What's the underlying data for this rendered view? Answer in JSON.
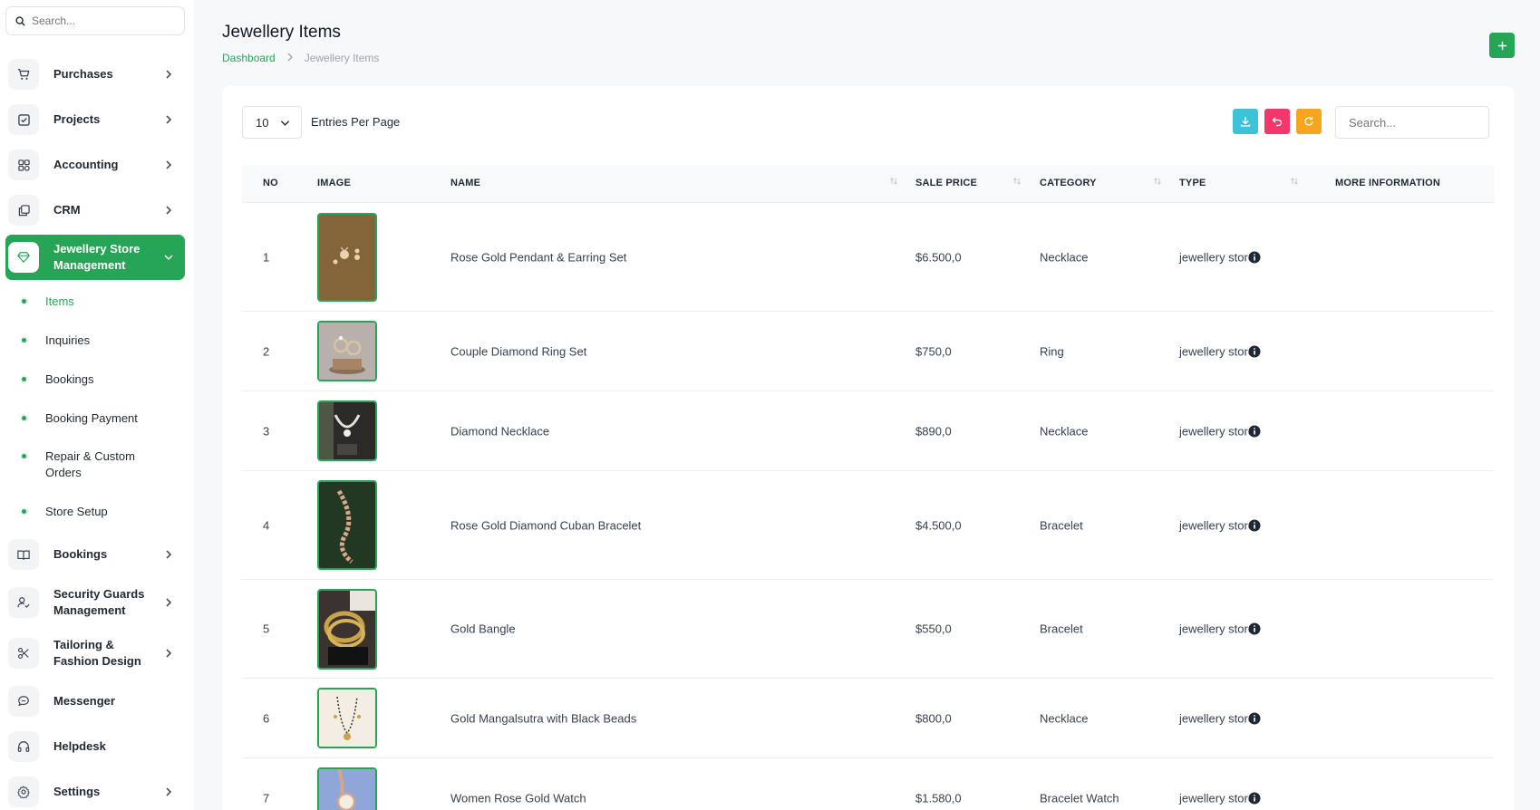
{
  "sidebar": {
    "search_placeholder": "Search...",
    "nav": [
      {
        "label": "Purchases",
        "icon": "cart-icon"
      },
      {
        "label": "Projects",
        "icon": "checkbox-icon"
      },
      {
        "label": "Accounting",
        "icon": "grid-icon"
      },
      {
        "label": "CRM",
        "icon": "copy-icon"
      },
      {
        "label": "Jewellery Store Management",
        "icon": "gem-icon"
      }
    ],
    "sub": [
      {
        "label": "Items"
      },
      {
        "label": "Inquiries"
      },
      {
        "label": "Bookings"
      },
      {
        "label": "Booking Payment"
      },
      {
        "label": "Repair & Custom Orders"
      },
      {
        "label": "Store Setup"
      }
    ],
    "nav2": [
      {
        "label": "Bookings",
        "icon": "book-icon"
      },
      {
        "label": "Security Guards Management",
        "icon": "user-check-icon"
      },
      {
        "label": "Tailoring & Fashion Design",
        "icon": "scissors-icon"
      },
      {
        "label": "Messenger",
        "icon": "chat-icon"
      },
      {
        "label": "Helpdesk",
        "icon": "headphones-icon"
      },
      {
        "label": "Settings",
        "icon": "gear-icon"
      }
    ]
  },
  "header": {
    "title": "Jewellery Items",
    "breadcrumb": {
      "home": "Dashboard",
      "current": "Jewellery Items"
    }
  },
  "toolbar": {
    "per_page_value": "10",
    "per_page_label": "Entries Per Page",
    "search_placeholder": "Search...",
    "colors": {
      "export": "#3cc2d9",
      "undo": "#f5366b",
      "refresh": "#f7a41f",
      "accent": "#27a557"
    }
  },
  "table": {
    "columns": [
      "NO",
      "IMAGE",
      "NAME",
      "SALE PRICE",
      "CATEGORY",
      "TYPE",
      "MORE INFORMATION"
    ],
    "rows": [
      {
        "no": "1",
        "name": "Rose Gold Pendant & Earring Set",
        "price": "$6.500,0",
        "category": "Necklace",
        "type": "jewellery store"
      },
      {
        "no": "2",
        "name": "Couple Diamond Ring Set",
        "price": "$750,0",
        "category": "Ring",
        "type": "jewellery store"
      },
      {
        "no": "3",
        "name": "Diamond Necklace",
        "price": "$890,0",
        "category": "Necklace",
        "type": "jewellery store"
      },
      {
        "no": "4",
        "name": "Rose Gold Diamond Cuban Bracelet",
        "price": "$4.500,0",
        "category": "Bracelet",
        "type": "jewellery store"
      },
      {
        "no": "5",
        "name": "Gold Bangle",
        "price": "$550,0",
        "category": "Bracelet",
        "type": "jewellery store"
      },
      {
        "no": "6",
        "name": "Gold Mangalsutra with Black Beads",
        "price": "$800,0",
        "category": "Necklace",
        "type": "jewellery store"
      },
      {
        "no": "7",
        "name": "Women Rose Gold Watch",
        "price": "$1.580,0",
        "category": "Bracelet Watch",
        "type": "jewellery store"
      }
    ]
  }
}
